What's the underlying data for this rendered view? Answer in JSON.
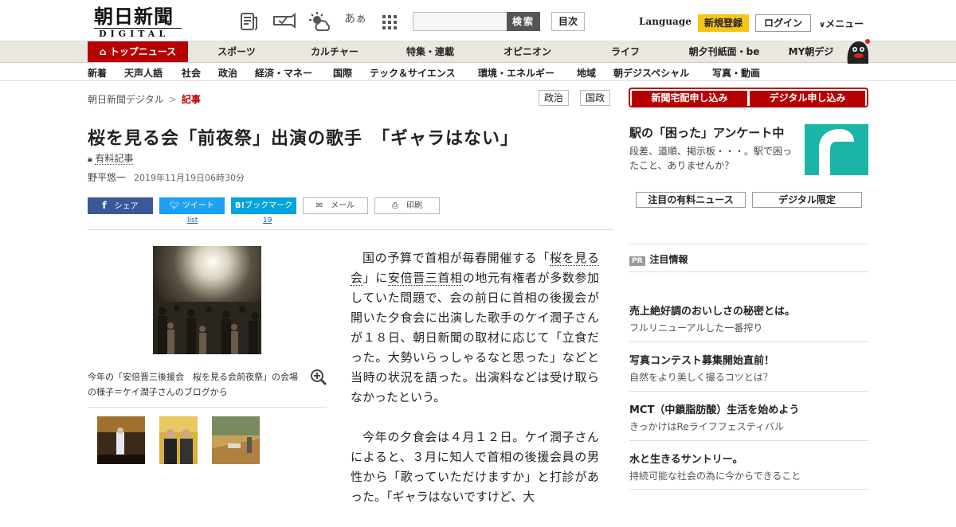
{
  "header": {
    "logo_title": "朝日新聞",
    "logo_sub": "DIGITAL",
    "search_button": "検索",
    "toc_button": "目次",
    "language": "Language",
    "register": "新規登録",
    "login": "ログイン",
    "menu": "メニュー",
    "font_size_glyph": "あぁ"
  },
  "global_nav": [
    "トップニュース",
    "スポーツ",
    "カルチャー",
    "特集・連載",
    "オピニオン",
    "ライフ",
    "朝夕刊紙面・be",
    "MY朝デジ"
  ],
  "sub_nav": [
    "新着",
    "天声人語",
    "社会",
    "政治",
    "経済・マネー",
    "国際",
    "テック＆サイエンス",
    "環境・エネルギー",
    "地域",
    "朝デジスペシャル",
    "写真・動画"
  ],
  "breadcrumb": {
    "home": "朝日新聞デジタル",
    "sep": ">",
    "current": "記事"
  },
  "tags": [
    "政治",
    "国政"
  ],
  "article": {
    "title": "桜を見る会「前夜祭」出演の歌手　「ギャラはない」",
    "paid_label": "有料記事",
    "author": "野平悠一",
    "date": "2019年11月19日06時30分",
    "share": {
      "facebook": "シェア",
      "twitter": "ツイート",
      "twitter_count": "list",
      "hatena": "ブックマーク",
      "hatena_count": "19",
      "mail": "メール",
      "print": "印刷"
    },
    "photo_caption": "今年の「安倍晋三後援会　桜を見る会前夜祭」の会場の様子＝ケイ潤子さんのブログから",
    "p1_a": "国の予算で首相が毎春開催する「",
    "p1_link1": "桜を見る会",
    "p1_b": "」に",
    "p1_link2": "安倍晋三首相",
    "p1_c": "の地元有権者が多数参加していた問題で、会の前日に首相の後援会が開いた夕食会に出演した歌手のケイ潤子さんが１８日、朝日新聞の取材に応じて「立食だった。大勢いらっしゃるなと思った」などと当時の状況を語った。出演料などは受け取らなかったという。",
    "p2": "今年の夕食会は４月１２日。ケイ潤子さんによると、３月に知人で首相の後援会員の男性から「歌っていただけますか」と打診があった。「ギャラはないですけど、大"
  },
  "sidebar": {
    "btn_home_delivery": "新聞宅配申し込み",
    "btn_digital": "デジタル申し込み",
    "enquete_title": "駅の「困った」アンケート中",
    "enquete_text": "段差、道順、掲示板・・・。駅で困ったこと、ありませんか？",
    "tab_paid": "注目の有料ニュース",
    "tab_digital": "デジタル限定",
    "pr_badge": "PR",
    "pr_title": "注目情報",
    "pr_items": [
      {
        "head": "売上絶好調のおいしさの秘密とは。",
        "sub": "フルリニューアルした一番搾り"
      },
      {
        "head": "写真コンテスト募集開始直前！",
        "sub": "自然をより美しく撮るコツとは？"
      },
      {
        "head": "MCT（中鎖脂肪酸）生活を始めよう",
        "sub": "きっかけはReライフフェスティバル"
      },
      {
        "head": "水と生きるサントリー。",
        "sub": "持続可能な社会の為に今からできること"
      }
    ]
  },
  "colors": {
    "brand_red": "#b70000",
    "facebook": "#3b5998",
    "twitter": "#1da1f2",
    "hatena": "#00a4de",
    "register": "#f5c518",
    "accent_teal": "#1bb5a8"
  }
}
